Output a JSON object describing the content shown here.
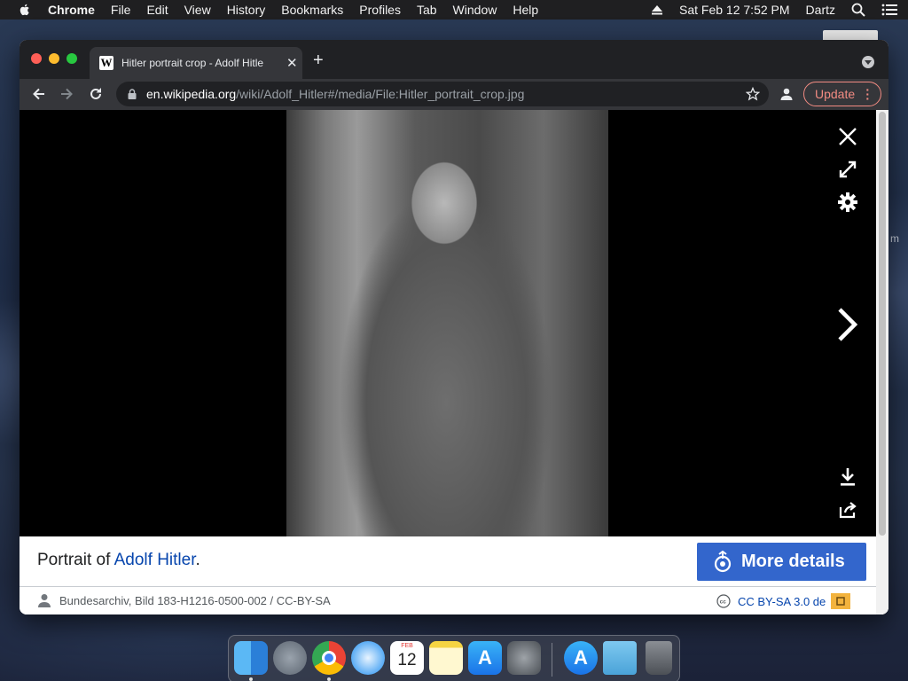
{
  "menubar": {
    "app": "Chrome",
    "items": [
      "File",
      "Edit",
      "View",
      "History",
      "Bookmarks",
      "Profiles",
      "Tab",
      "Window",
      "Help"
    ],
    "clock": "Sat Feb 12  7:52 PM",
    "user": "Dartz"
  },
  "desktop": {
    "partial_text": "m"
  },
  "browser": {
    "tab": {
      "title": "Hitler portrait crop - Adolf Hitle",
      "favicon": "W"
    },
    "new_tab": "+",
    "url": {
      "host": "en.wikipedia.org",
      "path": "/wiki/Adolf_Hitler#/media/File:Hitler_portrait_crop.jpg"
    },
    "update_label": "Update"
  },
  "viewer": {
    "caption_prefix": "Portrait of ",
    "caption_link": "Adolf Hitler",
    "caption_suffix": ".",
    "more_details": "More details",
    "attribution": "Bundesarchiv, Bild 183-H1216-0500-002 / CC-BY-SA",
    "license": "CC BY-SA 3.0 de",
    "colors": {
      "accent": "#3366cc",
      "link": "#0645ad",
      "update": "#f28b82"
    }
  },
  "dock": {
    "apps": [
      "finder-icon",
      "launchpad-icon",
      "chrome-icon",
      "safari-icon",
      "calendar-icon",
      "notes-icon",
      "app-store-icon",
      "system-preferences-icon",
      "app-store-download-icon",
      "downloads-folder-icon",
      "trash-icon"
    ],
    "calendar": {
      "month": "FEB",
      "day": "12"
    }
  }
}
